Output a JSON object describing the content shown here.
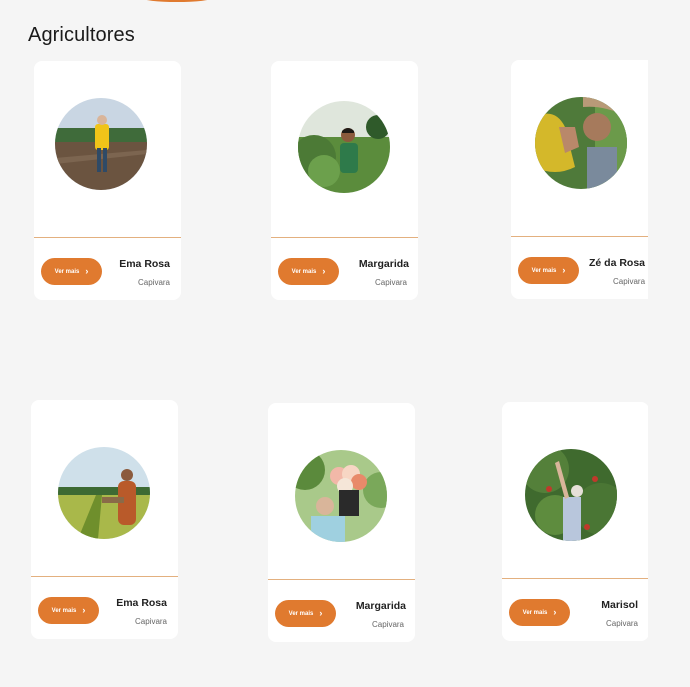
{
  "page": {
    "title": "Agricultores"
  },
  "cards": [
    {
      "name": "Ema Rosa",
      "location": "Capivara",
      "button_label": "Ver mais"
    },
    {
      "name": "Margarida",
      "location": "Capivara",
      "button_label": "Ver mais"
    },
    {
      "name": "Zé da Rosa",
      "location": "Capivara",
      "button_label": "Ver mais"
    },
    {
      "name": "Ema Rosa",
      "location": "Capivara",
      "button_label": "Ver mais"
    },
    {
      "name": "Margarida",
      "location": "Capivara",
      "button_label": "Ver mais"
    },
    {
      "name": "Marisol",
      "location": "Capivara",
      "button_label": "Ver mais"
    }
  ],
  "colors": {
    "accent": "#e07a2f",
    "background": "#f5f5f5",
    "card": "#ffffff",
    "divider": "#e3b07f"
  },
  "icons": {
    "button": "chevron-right-icon"
  }
}
